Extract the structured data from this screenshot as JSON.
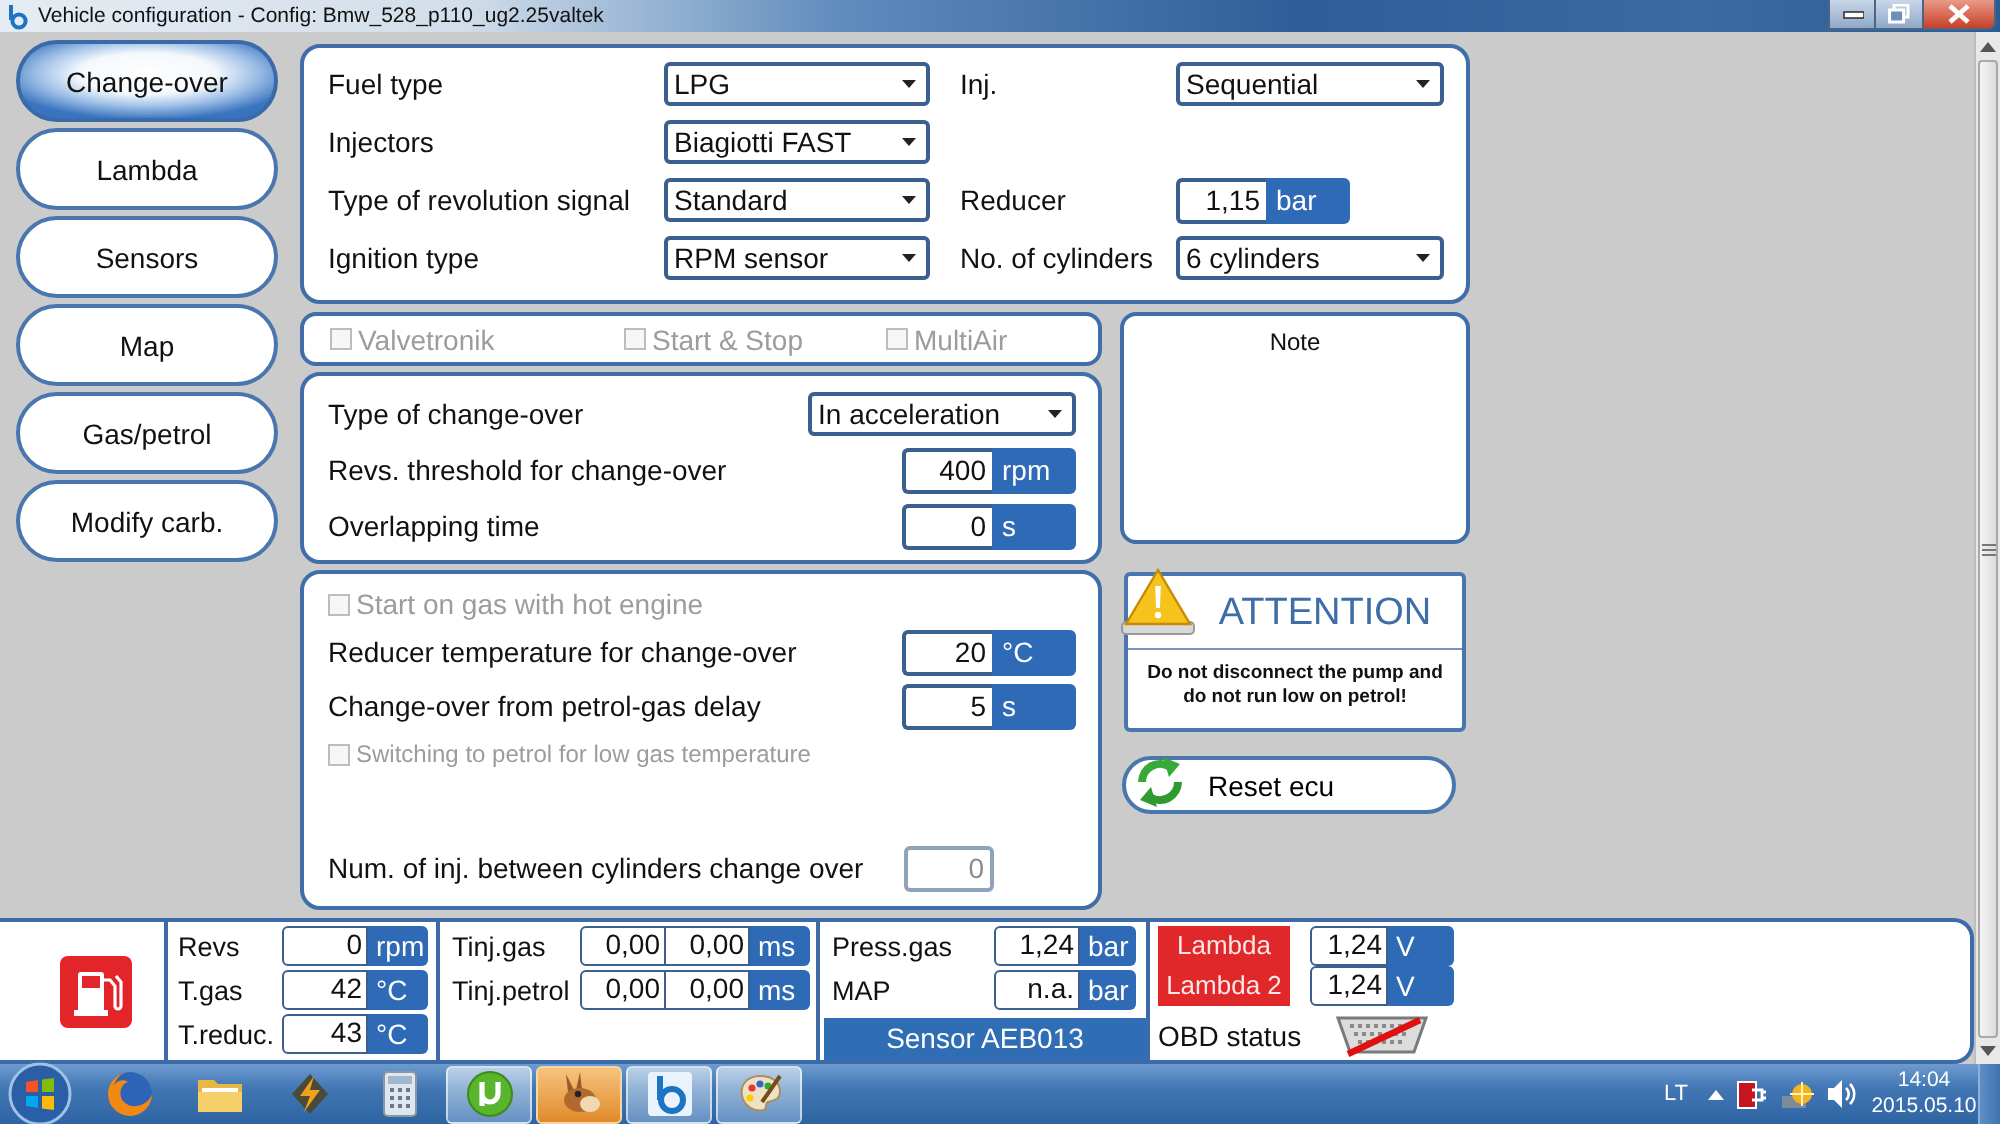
{
  "window": {
    "title": "Vehicle configuration - Config: Bmw_528_p110_ug2.25valtek"
  },
  "sidebar": {
    "items": [
      {
        "label": "Change-over",
        "selected": true
      },
      {
        "label": "Lambda",
        "selected": false
      },
      {
        "label": "Sensors",
        "selected": false
      },
      {
        "label": "Map",
        "selected": false
      },
      {
        "label": "Gas/petrol",
        "selected": false
      },
      {
        "label": "Modify carb.",
        "selected": false
      }
    ]
  },
  "vehicle": {
    "rows": [
      {
        "fields": [
          {
            "label": "Fuel type",
            "kind": "dropdown",
            "value": "LPG"
          },
          {
            "label": "Inj.",
            "kind": "dropdown",
            "value": "Sequential"
          }
        ]
      },
      {
        "fields": [
          {
            "label": "Injectors",
            "kind": "dropdown",
            "value": "Biagiotti FAST"
          }
        ]
      },
      {
        "fields": [
          {
            "label": "Type of revolution signal",
            "kind": "dropdown",
            "value": "Standard"
          },
          {
            "label": "Reducer",
            "kind": "number",
            "value": "1,15",
            "unit": "bar"
          }
        ]
      },
      {
        "fields": [
          {
            "label": "Ignition type",
            "kind": "dropdown",
            "value": "RPM sensor"
          },
          {
            "label": "No. of cylinders",
            "kind": "dropdown",
            "value": "6 cylinders"
          }
        ]
      }
    ]
  },
  "options": [
    {
      "label": "Valvetronik",
      "checked": false,
      "disabled": true
    },
    {
      "label": "Start & Stop",
      "checked": false,
      "disabled": true
    },
    {
      "label": "MultiAir",
      "checked": false,
      "disabled": true
    }
  ],
  "change_over": {
    "fields": [
      {
        "label": "Type of change-over",
        "kind": "dropdown",
        "value": "In acceleration"
      },
      {
        "label": "Revs. threshold for change-over",
        "kind": "number",
        "value": "400",
        "unit": "rpm"
      },
      {
        "label": "Overlapping time",
        "kind": "number",
        "value": "0",
        "unit": "s"
      }
    ]
  },
  "hot_engine": {
    "fields": [
      {
        "kind": "checkbox",
        "label": "Start on gas with hot engine",
        "checked": false,
        "disabled": true
      },
      {
        "kind": "number",
        "label": "Reducer temperature for change-over",
        "value": "20",
        "unit": "°C",
        "disabled": false
      },
      {
        "kind": "number",
        "label": "Change-over from petrol-gas delay",
        "value": "5",
        "unit": "s",
        "disabled": false
      },
      {
        "kind": "subcheckbox",
        "label": "Switching to petrol for low gas temperature",
        "checked": false,
        "disabled": true
      },
      {
        "kind": "number",
        "label": "Num. of inj. between cylinders change over",
        "value": "0",
        "disabled": true
      }
    ]
  },
  "note": {
    "title": "Note"
  },
  "attention": {
    "title": "ATTENTION",
    "message": "Do not disconnect the pump and do not run low on petrol!"
  },
  "reset_button": {
    "label": "Reset ecu"
  },
  "status_bar": {
    "engine": [
      {
        "label": "Revs",
        "value": "0",
        "unit": "rpm"
      },
      {
        "label": "T.gas",
        "value": "42",
        "unit": "°C"
      },
      {
        "label": "T.reduc.",
        "value": "43",
        "unit": "°C"
      }
    ],
    "injection": [
      {
        "label": "Tinj.gas",
        "values": [
          "0,00",
          "0,00"
        ],
        "unit": "ms"
      },
      {
        "label": "Tinj.petrol",
        "values": [
          "0,00",
          "0,00"
        ],
        "unit": "ms"
      }
    ],
    "pressure": {
      "fields": [
        {
          "label": "Press.gas",
          "value": "1,24",
          "unit": "bar"
        },
        {
          "label": "MAP",
          "value": "n.a.",
          "unit": "bar"
        }
      ],
      "sensor": "Sensor AEB013"
    },
    "lambda": [
      {
        "kind": "lambda",
        "label": "Lambda",
        "highlighted": true,
        "value": "1,24",
        "unit": "V"
      },
      {
        "kind": "lambda",
        "label": "Lambda 2",
        "highlighted": true,
        "value": "1,24",
        "unit": "V"
      },
      {
        "kind": "obd",
        "label": "OBD status",
        "connected": false
      }
    ]
  },
  "taskbar": {
    "apps": [
      {
        "running": false,
        "flashing": false
      },
      {
        "running": false,
        "flashing": false
      },
      {
        "running": false,
        "flashing": false
      },
      {
        "running": false,
        "flashing": false
      },
      {
        "running": true,
        "flashing": false
      },
      {
        "running": true,
        "flashing": true
      },
      {
        "running": true,
        "flashing": false
      },
      {
        "running": true,
        "flashing": false
      }
    ],
    "language": "LT",
    "time": "14:04",
    "date": "2015.05.10"
  }
}
